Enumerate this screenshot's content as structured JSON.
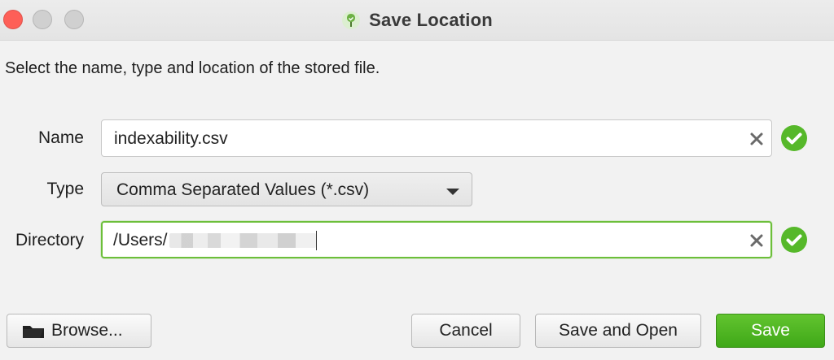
{
  "window": {
    "title": "Save Location",
    "controls": {
      "close": "close",
      "minimize": "minimize",
      "maximize": "maximize"
    }
  },
  "instruction": "Select the name, type and location of the stored file.",
  "form": {
    "name_label": "Name",
    "name_value": "indexability.csv",
    "type_label": "Type",
    "type_value": "Comma Separated Values (*.csv)",
    "directory_label": "Directory",
    "directory_prefix": "/Users/"
  },
  "buttons": {
    "browse": "Browse...",
    "cancel": "Cancel",
    "save_and_open": "Save and Open",
    "save": "Save"
  },
  "icons": {
    "app": "app-tree-icon",
    "clear": "clear-icon",
    "valid": "valid-check-icon",
    "dropdown": "chevron-down-icon",
    "folder": "folder-icon"
  },
  "colors": {
    "accent": "#4cb61f",
    "valid": "#56b82a",
    "close_button": "#fe5f57",
    "focus_border": "#6cbf3a"
  }
}
